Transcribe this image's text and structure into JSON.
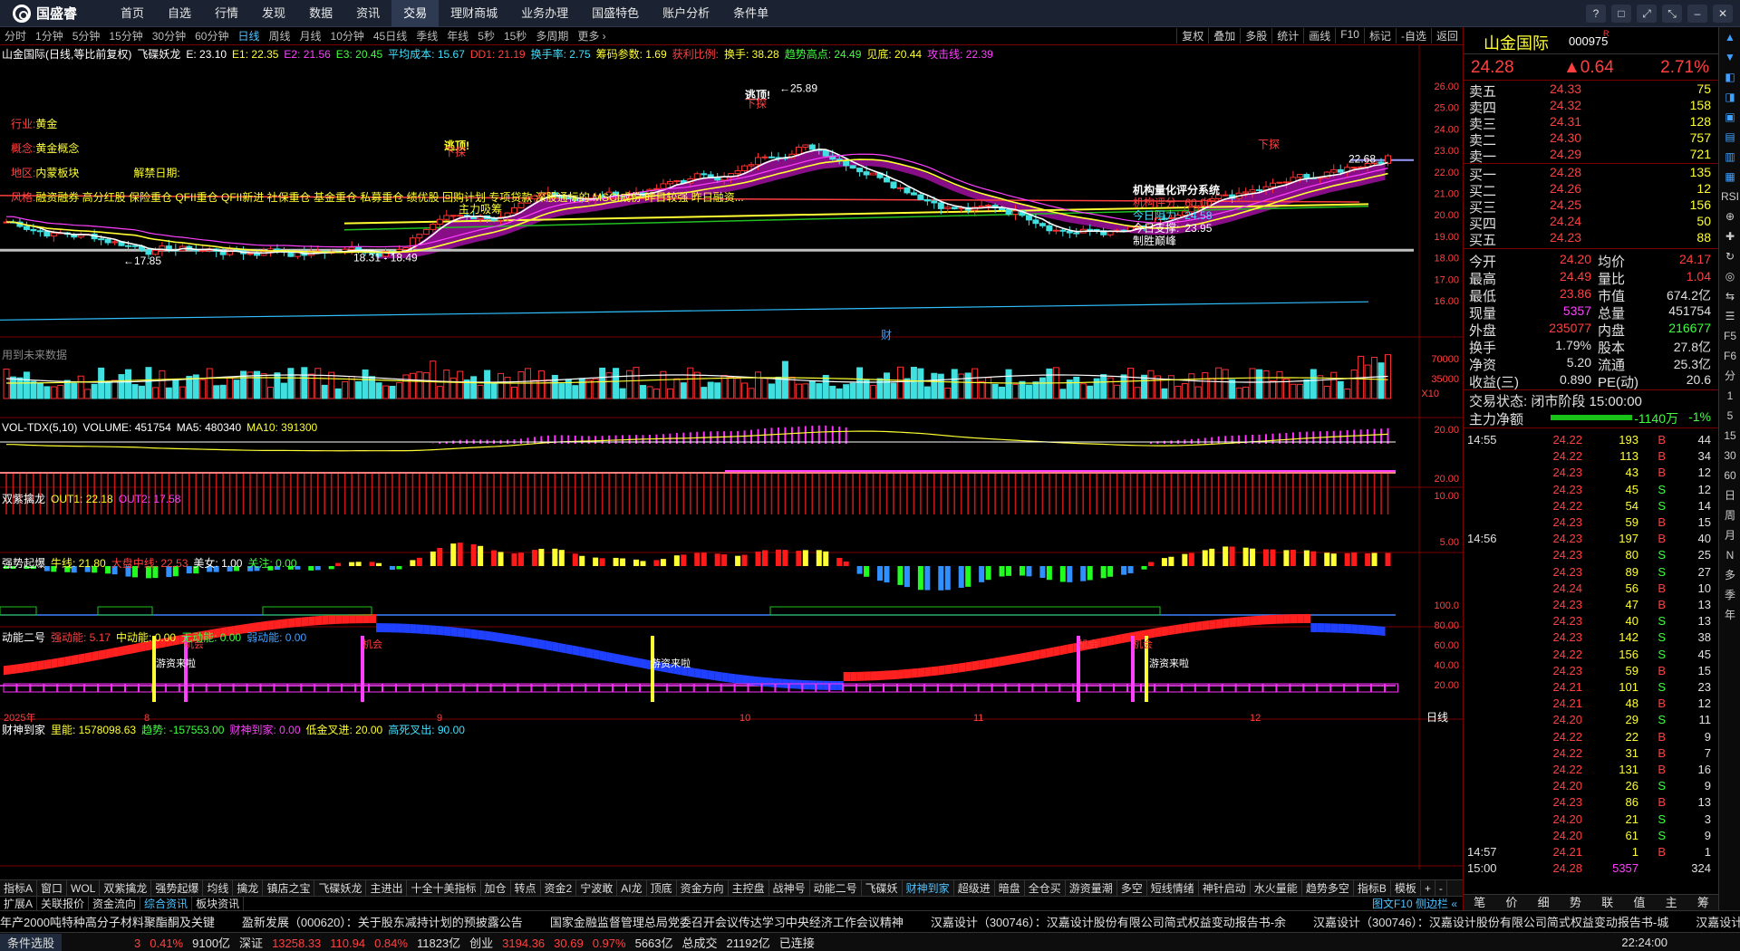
{
  "app": {
    "logo_text": "国盛睿",
    "menu": [
      "首页",
      "自选",
      "行情",
      "发现",
      "数据",
      "资讯",
      "交易",
      "理财商城",
      "业务办理",
      "国盛特色",
      "账户分析",
      "条件单"
    ],
    "active_menu": 6,
    "window_buttons": [
      "?",
      "□",
      "⤢",
      "⤡",
      "–",
      "✕"
    ]
  },
  "periods": [
    "分时",
    "1分钟",
    "5分钟",
    "15分钟",
    "30分钟",
    "60分钟",
    "日线",
    "周线",
    "月线",
    "10分钟",
    "45日线",
    "季线",
    "年线",
    "5秒",
    "15秒",
    "多周期",
    "更多 ›"
  ],
  "active_period": 6,
  "right_tools": [
    "复权",
    "叠加",
    "多股",
    "统计",
    "画线",
    "F10",
    "标记",
    "-自选",
    "返回"
  ],
  "main_title": {
    "name": "山金国际(日线,等比前复权)",
    "indicator": "飞碟妖龙",
    "items": [
      {
        "t": "E: 23.10",
        "c": "#ffffff"
      },
      {
        "t": "E1: 22.35",
        "c": "#ffff33"
      },
      {
        "t": "E2: 21.56",
        "c": "#ff40ff"
      },
      {
        "t": "E3: 20.45",
        "c": "#40ff40"
      },
      {
        "t": "平均成本: 15.67",
        "c": "#40e0ff"
      },
      {
        "t": "DD1: 21.19",
        "c": "#ff4040"
      },
      {
        "t": "换手率: 2.75",
        "c": "#40e0ff"
      },
      {
        "t": "筹码参数: 1.69",
        "c": "#ffff33"
      },
      {
        "t": "获利比例:",
        "c": "#ff4040"
      },
      {
        "t": "换手: 38.28",
        "c": "#ffff33"
      },
      {
        "t": "趋势高点: 24.49",
        "c": "#40ff40"
      },
      {
        "t": "见底: 20.44",
        "c": "#ffff33"
      },
      {
        "t": "攻击线: 22.39",
        "c": "#ff40ff"
      }
    ]
  },
  "stock_info": {
    "industry_label": "行业:",
    "industry": "黄金",
    "concept_label": "概念:",
    "concept": "黄金概念",
    "region_label": "地区:",
    "region": "内蒙板块",
    "extra": "解禁日期:",
    "style_label": "风格:",
    "style": "融资融券 高分红股 保险重仓 QFII重仓 QFII新进 社保重仓 基金重仓 私募重仓 绩优股 回购计划 专项贷款 深股通标的 MSCI成份 昨日较强 昨日融资..."
  },
  "annotations": {
    "high": "←25.89",
    "low": "←17.85",
    "range": "18.31 - 18.49",
    "right_range": "22.68",
    "escape": "逃顶!",
    "down": "下探",
    "main_force": "主力吸筹",
    "no_data": "用到未来数据",
    "finance": "财",
    "pos_label": "顶"
  },
  "sys": {
    "title": "机构量化评分系统",
    "items": [
      {
        "l": "机构评分:",
        "v": "60.00",
        "c": "#ff4040"
      },
      {
        "l": "今日阻力:",
        "v": "24.58",
        "c": "#40e0ff"
      },
      {
        "l": "今日支撑:",
        "v": "23.95",
        "c": "#ffffff"
      },
      {
        "l": "制胜巅峰",
        "v": "",
        "c": "#ffffff"
      }
    ]
  },
  "y_main": [
    "26.00",
    "25.00",
    "24.00",
    "23.00",
    "22.00",
    "21.00",
    "20.00",
    "19.00",
    "18.00",
    "17.00",
    "16.00"
  ],
  "vol_title": {
    "name": "VOL-TDX(5,10)",
    "items": [
      {
        "t": "VOLUME: 451754",
        "c": "#ffffff"
      },
      {
        "t": "MA5: 480340",
        "c": "#ffffff"
      },
      {
        "t": "MA10: 391300",
        "c": "#ffff33"
      }
    ]
  },
  "y_vol": [
    "70000",
    "35000",
    "X10"
  ],
  "p3_title": {
    "name": "双紫擒龙",
    "items": [
      {
        "t": "OUT1: 22.18",
        "c": "#ffff33"
      },
      {
        "t": "OUT2: 17.58",
        "c": "#ff40ff"
      }
    ]
  },
  "y_p3": [
    "20.00"
  ],
  "p4_title": {
    "name": "强势起爆",
    "items": [
      {
        "t": "牛线: 21.80",
        "c": "#ffff33"
      },
      {
        "t": "大盘中线: 22.53",
        "c": "#ff4040"
      },
      {
        "t": "美女: 1.00",
        "c": "#ffffff"
      },
      {
        "t": "关注: 0.00",
        "c": "#40ff40"
      }
    ]
  },
  "y_p4": [
    "20.00",
    "10.00"
  ],
  "p5_title": {
    "name": "动能二号",
    "items": [
      {
        "t": "强动能: 5.17",
        "c": "#ff4040"
      },
      {
        "t": "中动能: 0.00",
        "c": "#ffff33"
      },
      {
        "t": "无动能: 0.00",
        "c": "#40ff40"
      },
      {
        "t": "弱动能: 0.00",
        "c": "#40a0ff"
      }
    ]
  },
  "y_p5": [
    "5.00"
  ],
  "p6_title": {
    "name": "财神到家",
    "items": [
      {
        "t": "里能: 1578098.63",
        "c": "#ffff33"
      },
      {
        "t": "趋势: -157553.00",
        "c": "#40ff40"
      },
      {
        "t": "财神到家: 0.00",
        "c": "#ff40ff"
      },
      {
        "t": "低金叉进: 20.00",
        "c": "#ffff33"
      },
      {
        "t": "高死叉出: 90.00",
        "c": "#40e0ff"
      }
    ]
  },
  "y_p6": [
    "100.0",
    "80.00",
    "60.00",
    "40.00",
    "20.00"
  ],
  "p6_labels": {
    "chance": "机会",
    "hot": "游资来啦"
  },
  "x_dates": [
    "2025年",
    "8",
    "9",
    "10",
    "11",
    "12"
  ],
  "bottom_label": "日线",
  "bottom_tabs": [
    "指标A",
    "窗口",
    "WOL",
    "双紫擒龙",
    "强势起爆",
    "均线",
    "擒龙",
    "镇店之宝",
    "飞碟妖龙",
    "主进出",
    "十全十美指标",
    "加仓",
    "转点",
    "资金2",
    "宁波敢",
    "AI龙",
    "顶底",
    "资金方向",
    "主控盘",
    "战神号",
    "动能二号",
    "飞碟妖",
    "财神到家",
    "超级进",
    "暗盘",
    "全仓买",
    "游资量潮",
    "多空",
    "短线情绪",
    "神针启动",
    "水火量能",
    "趋势多空",
    "指标B",
    "模板",
    "+",
    "-"
  ],
  "active_bottom": 22,
  "sub_tabs": [
    "扩展A",
    "关联报价",
    "资金流向",
    "综合资讯",
    "板块资讯"
  ],
  "active_sub": 3,
  "sub_right": "图文F10 侧边栏 «",
  "news": [
    "年产2000吨特种高分子材料聚酯酮及关键",
    "盈新发展（000620）：关于股东减持计划的预披露公告",
    "国家金融监督管理总局党委召开会议传达学习中央经济工作会议精神",
    "汉嘉设计（300746）：汉嘉设计股份有限公司简式权益变动报告书-余",
    "汉嘉设计（300746）：汉嘉设计股份有限公司简式权益变动报告书-城",
    "汉嘉设计（3"
  ],
  "status": {
    "tool": "条件选股",
    "items": [
      {
        "t": "3",
        "c": "#ff4040"
      },
      {
        "t": "0.41%",
        "c": "#ff4040"
      },
      {
        "t": "9100亿",
        "c": "#e0e0e0"
      },
      {
        "t": "深证",
        "c": "#e0e0e0"
      },
      {
        "t": "13258.33",
        "c": "#ff4040"
      },
      {
        "t": "110.94",
        "c": "#ff4040"
      },
      {
        "t": "0.84%",
        "c": "#ff4040"
      },
      {
        "t": "11823亿",
        "c": "#e0e0e0"
      },
      {
        "t": "创业",
        "c": "#e0e0e0"
      },
      {
        "t": "3194.36",
        "c": "#ff4040"
      },
      {
        "t": "30.69",
        "c": "#ff4040"
      },
      {
        "t": "0.97%",
        "c": "#ff4040"
      },
      {
        "t": "5663亿",
        "c": "#e0e0e0"
      },
      {
        "t": "总成交",
        "c": "#e0e0e0"
      },
      {
        "t": "21192亿",
        "c": "#e0e0e0"
      },
      {
        "t": "已连接",
        "c": "#e0e0e0"
      }
    ],
    "time": "22:24:00"
  },
  "quote": {
    "name": "山金国际",
    "code": "000975",
    "tag": "R",
    "price": "24.28",
    "change": "▲0.64",
    "pct": "2.71%",
    "asks": [
      {
        "l": "卖五",
        "p": "24.33",
        "v": "75"
      },
      {
        "l": "卖四",
        "p": "24.32",
        "v": "158"
      },
      {
        "l": "卖三",
        "p": "24.31",
        "v": "128"
      },
      {
        "l": "卖二",
        "p": "24.30",
        "v": "757"
      },
      {
        "l": "卖一",
        "p": "24.29",
        "v": "721"
      }
    ],
    "bids": [
      {
        "l": "买一",
        "p": "24.28",
        "v": "135"
      },
      {
        "l": "买二",
        "p": "24.26",
        "v": "12"
      },
      {
        "l": "买三",
        "p": "24.25",
        "v": "156"
      },
      {
        "l": "买四",
        "p": "24.24",
        "v": "50"
      },
      {
        "l": "买五",
        "p": "24.23",
        "v": "88"
      }
    ],
    "stats": [
      {
        "a": "今开",
        "av": "24.20",
        "b": "均价",
        "bv": "24.17"
      },
      {
        "a": "最高",
        "av": "24.49",
        "b": "量比",
        "bv": "1.04"
      },
      {
        "a": "最低",
        "av": "23.86",
        "b": "市值",
        "bv": "674.2亿"
      },
      {
        "a": "现量",
        "av": "5357",
        "b": "总量",
        "bv": "451754"
      },
      {
        "a": "外盘",
        "av": "235077",
        "b": "内盘",
        "bv": "216677"
      },
      {
        "a": "换手",
        "av": "1.79%",
        "b": "股本",
        "bv": "27.8亿"
      },
      {
        "a": "净资",
        "av": "5.20",
        "b": "流通",
        "bv": "25.3亿"
      },
      {
        "a": "收益(三)",
        "av": "0.890",
        "b": "PE(动)",
        "bv": "20.6"
      }
    ],
    "state": "交易状态: 闭市阶段 15:00:00",
    "netflow_label": "主力净额",
    "netflow": "-1140万",
    "netflow_pct": "-1%",
    "ticks": [
      {
        "t": "14:55",
        "p": "24.22",
        "v": "193",
        "d": "B",
        "n": "44"
      },
      {
        "t": "",
        "p": "24.22",
        "v": "113",
        "d": "B",
        "n": "34"
      },
      {
        "t": "",
        "p": "24.23",
        "v": "43",
        "d": "B",
        "n": "12"
      },
      {
        "t": "",
        "p": "24.23",
        "v": "45",
        "d": "S",
        "n": "12"
      },
      {
        "t": "",
        "p": "24.22",
        "v": "54",
        "d": "S",
        "n": "14"
      },
      {
        "t": "",
        "p": "24.23",
        "v": "59",
        "d": "B",
        "n": "15"
      },
      {
        "t": "14:56",
        "p": "24.23",
        "v": "197",
        "d": "B",
        "n": "40"
      },
      {
        "t": "",
        "p": "24.23",
        "v": "80",
        "d": "S",
        "n": "25"
      },
      {
        "t": "",
        "p": "24.23",
        "v": "89",
        "d": "S",
        "n": "27"
      },
      {
        "t": "",
        "p": "24.24",
        "v": "56",
        "d": "B",
        "n": "10"
      },
      {
        "t": "",
        "p": "24.23",
        "v": "47",
        "d": "B",
        "n": "13"
      },
      {
        "t": "",
        "p": "24.23",
        "v": "40",
        "d": "S",
        "n": "13"
      },
      {
        "t": "",
        "p": "24.23",
        "v": "142",
        "d": "S",
        "n": "38"
      },
      {
        "t": "",
        "p": "24.22",
        "v": "156",
        "d": "S",
        "n": "45"
      },
      {
        "t": "",
        "p": "24.23",
        "v": "59",
        "d": "B",
        "n": "15"
      },
      {
        "t": "",
        "p": "24.21",
        "v": "101",
        "d": "S",
        "n": "23"
      },
      {
        "t": "",
        "p": "24.21",
        "v": "48",
        "d": "B",
        "n": "12"
      },
      {
        "t": "",
        "p": "24.20",
        "v": "29",
        "d": "S",
        "n": "11"
      },
      {
        "t": "",
        "p": "24.22",
        "v": "22",
        "d": "B",
        "n": "9"
      },
      {
        "t": "",
        "p": "24.22",
        "v": "31",
        "d": "B",
        "n": "7"
      },
      {
        "t": "",
        "p": "24.22",
        "v": "131",
        "d": "B",
        "n": "16"
      },
      {
        "t": "",
        "p": "24.20",
        "v": "26",
        "d": "S",
        "n": "9"
      },
      {
        "t": "",
        "p": "24.23",
        "v": "86",
        "d": "B",
        "n": "13"
      },
      {
        "t": "",
        "p": "24.20",
        "v": "21",
        "d": "S",
        "n": "3"
      },
      {
        "t": "",
        "p": "24.20",
        "v": "61",
        "d": "S",
        "n": "9"
      },
      {
        "t": "14:57",
        "p": "24.21",
        "v": "1",
        "d": "B",
        "n": "1"
      },
      {
        "t": "15:00",
        "p": "24.28",
        "v": "5357",
        "d": "",
        "n": "324"
      }
    ],
    "foot": [
      "笔",
      "价",
      "细",
      "势",
      "联",
      "值",
      "主",
      "筹"
    ]
  },
  "sidebar": [
    "▲",
    "▼",
    "◧",
    "◨",
    "▣",
    "▤",
    "▥",
    "▦",
    "RSI",
    "⊕",
    "✚",
    "↻",
    "◎",
    "⇆",
    "☰",
    "F5",
    "F6",
    "分",
    "1",
    "5",
    "15",
    "30",
    "60",
    "日",
    "周",
    "月",
    "N",
    "多",
    "季",
    "年"
  ]
}
